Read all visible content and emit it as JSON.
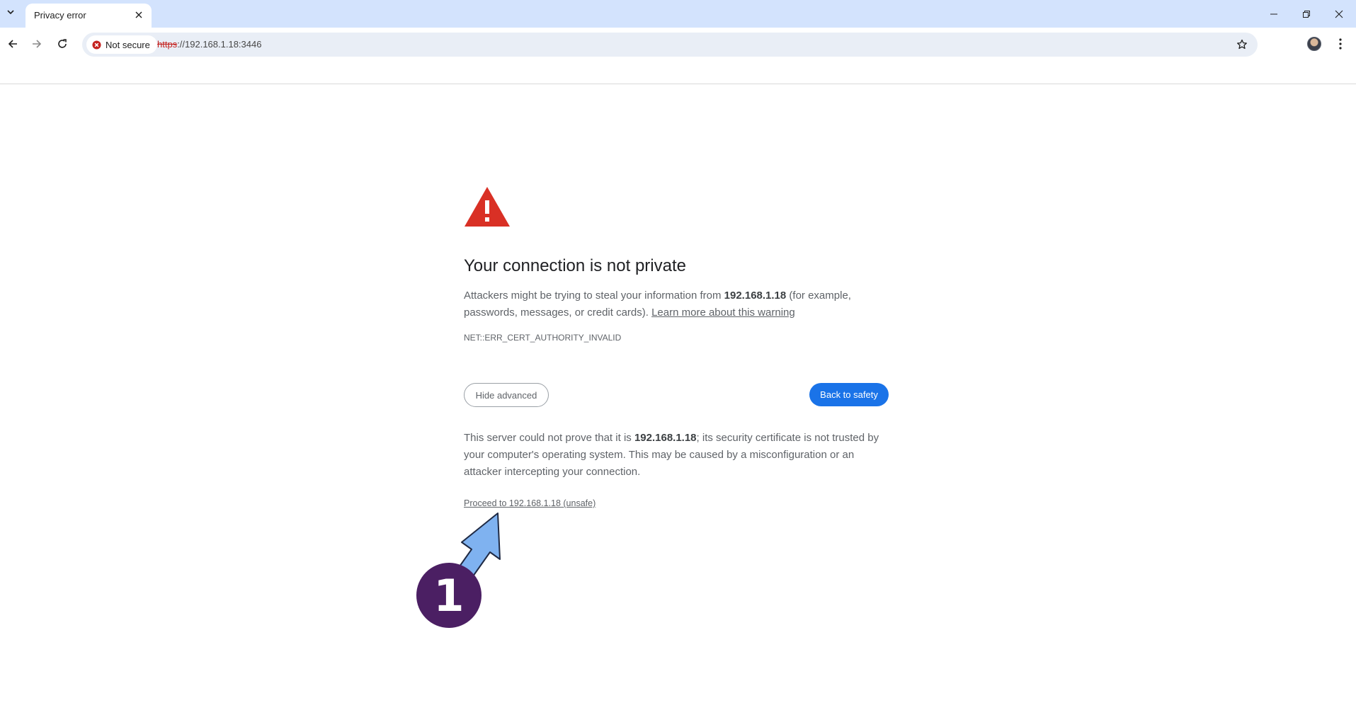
{
  "browser": {
    "tab_title": "Privacy error",
    "security_chip": "Not secure",
    "url_scheme": "https",
    "url_rest": "://192.168.1.18:3446",
    "colors": {
      "tabstrip": "#d3e3fd",
      "omnibox": "#e9eef6",
      "warning_red": "#d93025"
    },
    "icons": [
      "tab-search-icon",
      "close-icon",
      "minimize-icon",
      "restore-icon",
      "back-arrow-icon",
      "forward-arrow-icon",
      "reload-icon",
      "not-secure-icon",
      "bookmark-star-icon",
      "profile-avatar",
      "kebab-menu-icon"
    ]
  },
  "page": {
    "heading": "Your connection is not private",
    "para1_prefix": "Attackers might be trying to steal your information from ",
    "host": "192.168.1.18",
    "para1_suffix": " (for example, passwords, messages, or credit cards). ",
    "learn_more": "Learn more about this warning",
    "error_code": "NET::ERR_CERT_AUTHORITY_INVALID",
    "hide_advanced": "Hide advanced",
    "back_to_safety": "Back to safety",
    "para2_prefix": "This server could not prove that it is ",
    "para2_suffix": "; its security certificate is not trusted by your computer's operating system. This may be caused by a misconfiguration or an attacker intercepting your connection.",
    "proceed_link": "Proceed to 192.168.1.18 (unsafe)",
    "colors": {
      "primary_button": "#1a73e8",
      "text": "#5f6368"
    }
  },
  "annotation": {
    "step_number": "1",
    "colors": {
      "badge": "#4b1f63",
      "arrow": "#7fb2f0"
    }
  }
}
